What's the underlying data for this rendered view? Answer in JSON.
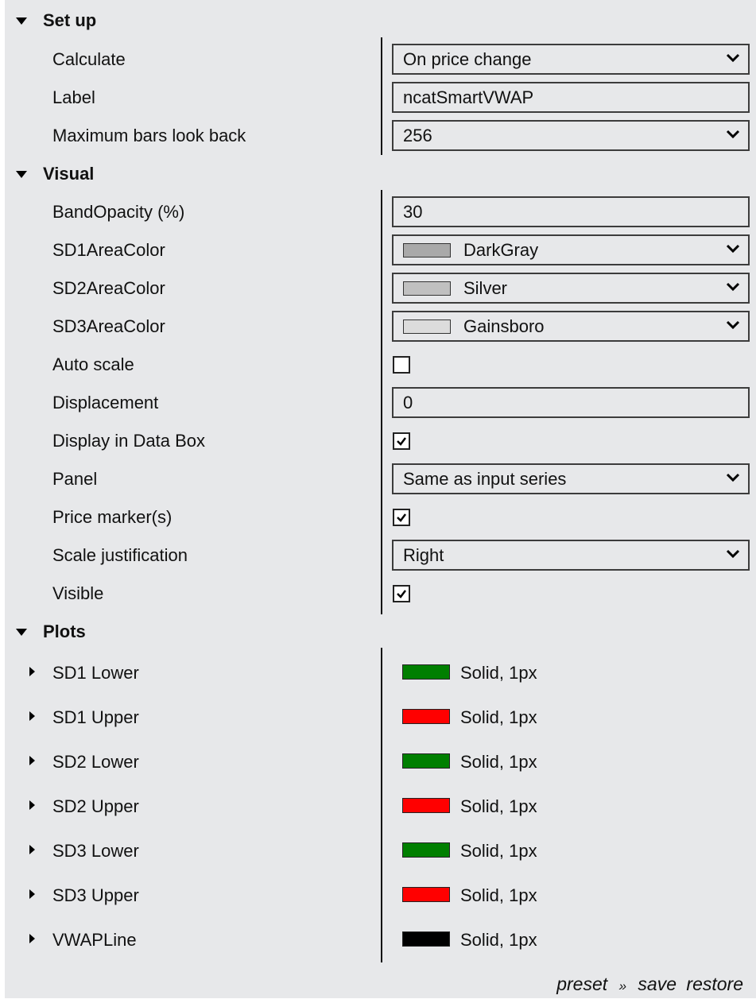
{
  "sections": {
    "setup": {
      "title": "Set up"
    },
    "visual": {
      "title": "Visual"
    },
    "plots": {
      "title": "Plots"
    }
  },
  "setup": {
    "calculate": {
      "label": "Calculate",
      "value": "On price change"
    },
    "label": {
      "label": "Label",
      "value": "ncatSmartVWAP"
    },
    "max_bars": {
      "label": "Maximum bars look back",
      "value": "256"
    }
  },
  "visual": {
    "band_opacity": {
      "label": "BandOpacity (%)",
      "value": "30"
    },
    "sd1_area_color": {
      "label": "SD1AreaColor",
      "value": "DarkGray",
      "color": "#a9a9a9"
    },
    "sd2_area_color": {
      "label": "SD2AreaColor",
      "value": "Silver",
      "color": "#c0c0c0"
    },
    "sd3_area_color": {
      "label": "SD3AreaColor",
      "value": "Gainsboro",
      "color": "#dcdcdc"
    },
    "auto_scale": {
      "label": "Auto scale",
      "checked": false
    },
    "displacement": {
      "label": "Displacement",
      "value": "0"
    },
    "display_in_data_box": {
      "label": "Display in Data Box",
      "checked": true
    },
    "panel": {
      "label": "Panel",
      "value": "Same as input series"
    },
    "price_markers": {
      "label": "Price marker(s)",
      "checked": true
    },
    "scale_justification": {
      "label": "Scale justification",
      "value": "Right"
    },
    "visible": {
      "label": "Visible",
      "checked": true
    }
  },
  "plots": {
    "items": [
      {
        "label": "SD1 Lower",
        "color": "#007f00",
        "style": "Solid, 1px"
      },
      {
        "label": "SD1 Upper",
        "color": "#ff0000",
        "style": "Solid, 1px"
      },
      {
        "label": "SD2 Lower",
        "color": "#007f00",
        "style": "Solid, 1px"
      },
      {
        "label": "SD2 Upper",
        "color": "#ff0000",
        "style": "Solid, 1px"
      },
      {
        "label": "SD3 Lower",
        "color": "#007f00",
        "style": "Solid, 1px"
      },
      {
        "label": "SD3 Upper",
        "color": "#ff0000",
        "style": "Solid, 1px"
      },
      {
        "label": "VWAPLine",
        "color": "#000000",
        "style": "Solid, 1px"
      }
    ]
  },
  "footer": {
    "preset": "preset",
    "separator": "»",
    "save": "save",
    "restore": "restore"
  }
}
